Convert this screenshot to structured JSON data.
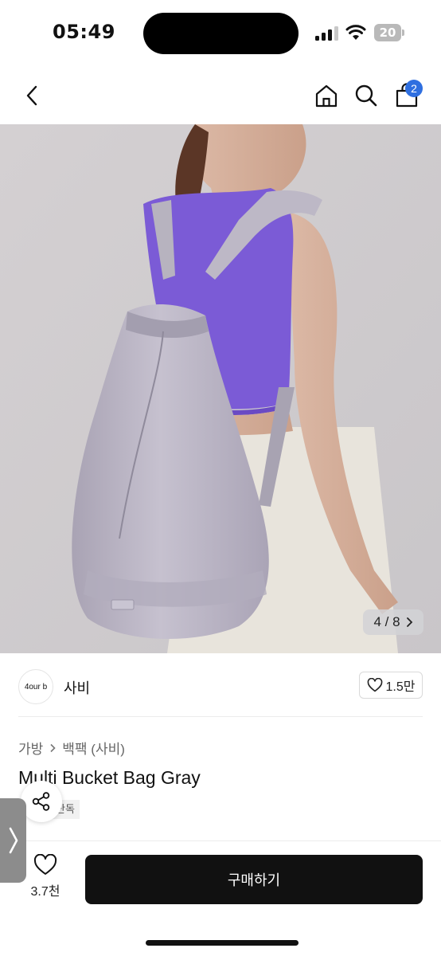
{
  "status_bar": {
    "time": "05:49",
    "battery": "20"
  },
  "nav": {
    "cart_badge": "2"
  },
  "hero": {
    "image_index": "4 / 8",
    "image_current": 4,
    "image_total": 8
  },
  "seller": {
    "logo_text": "4our b",
    "name": "사비",
    "likes": "1.5만"
  },
  "product": {
    "breadcrumb": [
      "가방",
      "백팩 (사비)"
    ],
    "title": "Multi Bucket Bag Gray",
    "badge": "단독"
  },
  "bottom_bar": {
    "wish_count": "3.7천",
    "buy_label": "구매하기"
  },
  "colors": {
    "accent_blue": "#2f6fe0",
    "buy_button": "#111111",
    "top_color": "#7b5bd6",
    "bag_color": "#bdb8c6"
  },
  "icons": [
    "back-chevron-icon",
    "home-icon",
    "search-icon",
    "cart-icon",
    "heart-icon",
    "share-icon",
    "chevron-right-icon"
  ]
}
